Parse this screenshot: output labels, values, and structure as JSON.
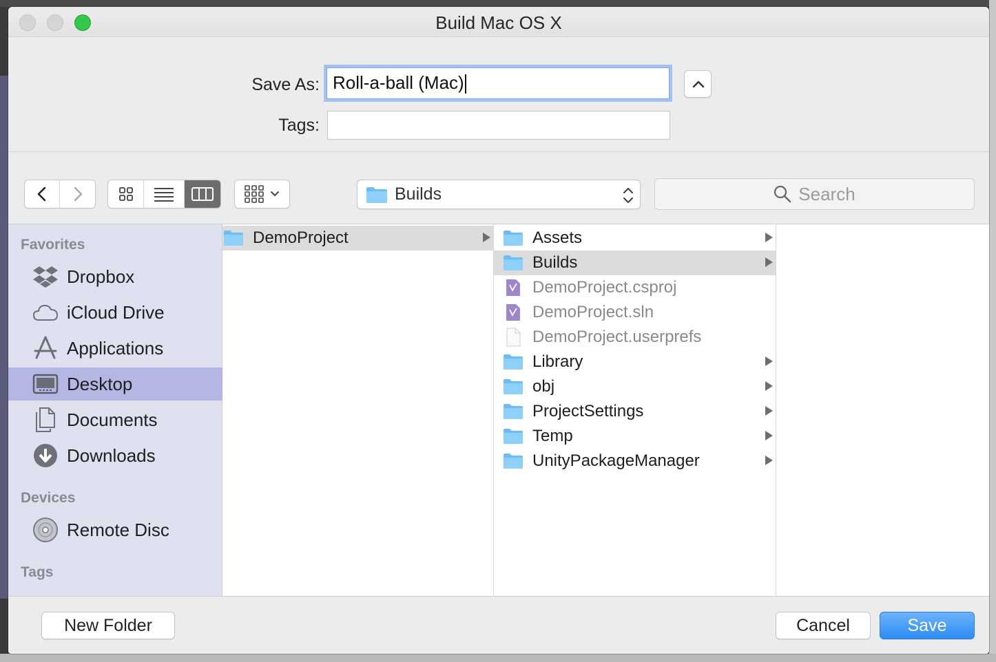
{
  "window": {
    "title": "Build Mac OS X"
  },
  "form": {
    "save_as_label": "Save As:",
    "save_as_value": "Roll-a-ball (Mac)",
    "tags_label": "Tags:",
    "tags_value": ""
  },
  "toolbar": {
    "path_label": "Builds",
    "search_placeholder": "Search",
    "active_view": "columns"
  },
  "sidebar": {
    "favorites_header": "Favorites",
    "favorites": [
      {
        "label": "Dropbox",
        "icon": "dropbox-icon"
      },
      {
        "label": "iCloud Drive",
        "icon": "cloud-icon"
      },
      {
        "label": "Applications",
        "icon": "applications-icon"
      },
      {
        "label": "Desktop",
        "icon": "desktop-icon",
        "selected": true
      },
      {
        "label": "Documents",
        "icon": "documents-icon"
      },
      {
        "label": "Downloads",
        "icon": "downloads-icon"
      }
    ],
    "devices_header": "Devices",
    "devices": [
      {
        "label": "Remote Disc",
        "icon": "disc-icon"
      }
    ],
    "tags_header": "Tags"
  },
  "columns": {
    "col1": [
      {
        "label": "DemoProject",
        "type": "folder",
        "selected": true,
        "has_children": true
      }
    ],
    "col2": [
      {
        "label": "Assets",
        "type": "folder",
        "has_children": true
      },
      {
        "label": "Builds",
        "type": "folder",
        "selected": true,
        "has_children": true
      },
      {
        "label": "DemoProject.csproj",
        "type": "vs-file",
        "dim": true
      },
      {
        "label": "DemoProject.sln",
        "type": "vs-file",
        "dim": true
      },
      {
        "label": "DemoProject.userprefs",
        "type": "blank-file",
        "dim": true
      },
      {
        "label": "Library",
        "type": "folder",
        "has_children": true
      },
      {
        "label": "obj",
        "type": "folder",
        "has_children": true
      },
      {
        "label": "ProjectSettings",
        "type": "folder",
        "has_children": true
      },
      {
        "label": "Temp",
        "type": "folder",
        "has_children": true
      },
      {
        "label": "UnityPackageManager",
        "type": "folder",
        "has_children": true
      }
    ]
  },
  "footer": {
    "new_folder_label": "New Folder",
    "cancel_label": "Cancel",
    "save_label": "Save"
  },
  "colors": {
    "accent": "#2c8cf4",
    "sidebar_bg": "#dfe0f0",
    "sidebar_selected": "#b4b6e4",
    "folder": "#6cbcf5"
  }
}
